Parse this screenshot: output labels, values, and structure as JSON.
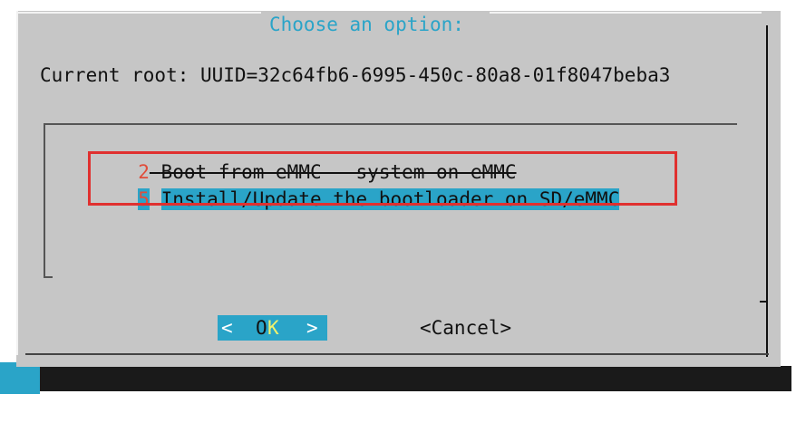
{
  "dialog": {
    "title": "Choose an option:",
    "current_root": "Current root: UUID=32c64fb6-6995-450c-80a8-01f8047beba3"
  },
  "menu": {
    "items": [
      {
        "number": "2",
        "label": "Boot from eMMC - system on eMMC",
        "selected": false
      },
      {
        "number": "5",
        "label": "Install/Update the bootloader on SD/eMMC",
        "selected": true
      }
    ]
  },
  "buttons": {
    "ok": {
      "left": "<",
      "o": "O",
      "k": "K",
      "right": ">"
    },
    "cancel": "<Cancel>"
  },
  "colors": {
    "dialog_bg": "#c6c6c6",
    "accent": "#2aa4c8",
    "number_red": "#e04d3a",
    "highlight_red": "#e0302f",
    "hotkey_yellow": "#f3f36b"
  }
}
